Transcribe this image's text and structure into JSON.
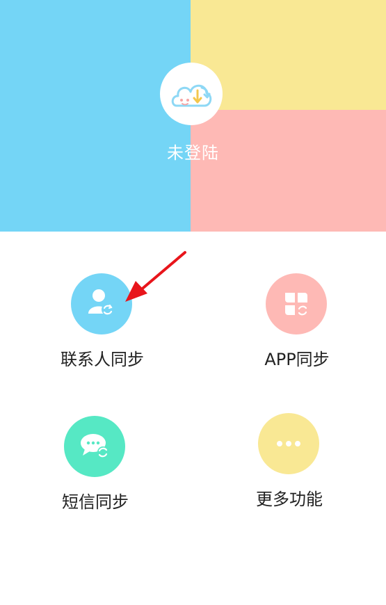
{
  "header": {
    "login_status": "未登陆",
    "colors": {
      "left": "#74d5f6",
      "top_right": "#f9e894",
      "bottom_right": "#feb9b5"
    }
  },
  "features": [
    {
      "label": "联系人同步",
      "icon": "contact-sync-icon",
      "color": "#74d5f6"
    },
    {
      "label": "APP同步",
      "icon": "app-sync-icon",
      "color": "#feb9b5"
    },
    {
      "label": "短信同步",
      "icon": "sms-sync-icon",
      "color": "#56e8c4"
    },
    {
      "label": "更多功能",
      "icon": "more-icon",
      "color": "#f9e894"
    }
  ],
  "annotation": {
    "arrow_color": "#e8151b",
    "arrow_target": "contacts-sync-button"
  }
}
